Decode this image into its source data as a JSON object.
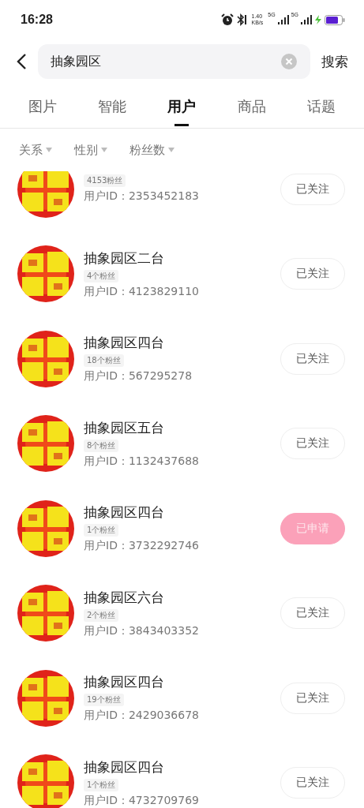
{
  "status_bar": {
    "time": "16:28",
    "speed": "1.40",
    "speed_unit": "KB/s",
    "networks": [
      "5G",
      "5G"
    ]
  },
  "search": {
    "value": "抽象园区",
    "button": "搜索"
  },
  "tabs": [
    {
      "label": "图片",
      "selected": false
    },
    {
      "label": "智能",
      "selected": false
    },
    {
      "label": "用户",
      "selected": true
    },
    {
      "label": "商品",
      "selected": false
    },
    {
      "label": "话题",
      "selected": false
    }
  ],
  "filters": [
    "关系",
    "性别",
    "粉丝数"
  ],
  "users": [
    {
      "fans": "4153粉丝",
      "user_id": "用户ID：2353452183",
      "button": "已关注",
      "kind": "followed"
    },
    {
      "name": "抽象园区二台",
      "fans": "4个粉丝",
      "user_id": "用户ID：4123829110",
      "button": "已关注",
      "kind": "followed"
    },
    {
      "name": "抽象园区四台",
      "fans": "18个粉丝",
      "user_id": "用户ID：567295278",
      "button": "已关注",
      "kind": "followed"
    },
    {
      "name": "抽象园区五台",
      "fans": "8个粉丝",
      "user_id": "用户ID：1132437688",
      "button": "已关注",
      "kind": "followed"
    },
    {
      "name": "抽象园区四台",
      "fans": "1个粉丝",
      "user_id": "用户ID：3732292746",
      "button": "已申请",
      "kind": "requested"
    },
    {
      "name": "抽象园区六台",
      "fans": "2个粉丝",
      "user_id": "用户ID：3843403352",
      "button": "已关注",
      "kind": "followed"
    },
    {
      "name": "抽象园区四台",
      "fans": "19个粉丝",
      "user_id": "用户ID：2429036678",
      "button": "已关注",
      "kind": "followed"
    },
    {
      "name": "抽象园区四台",
      "fans": "1个粉丝",
      "user_id": "用户ID：4732709769",
      "button": "已关注",
      "kind": "followed"
    }
  ]
}
